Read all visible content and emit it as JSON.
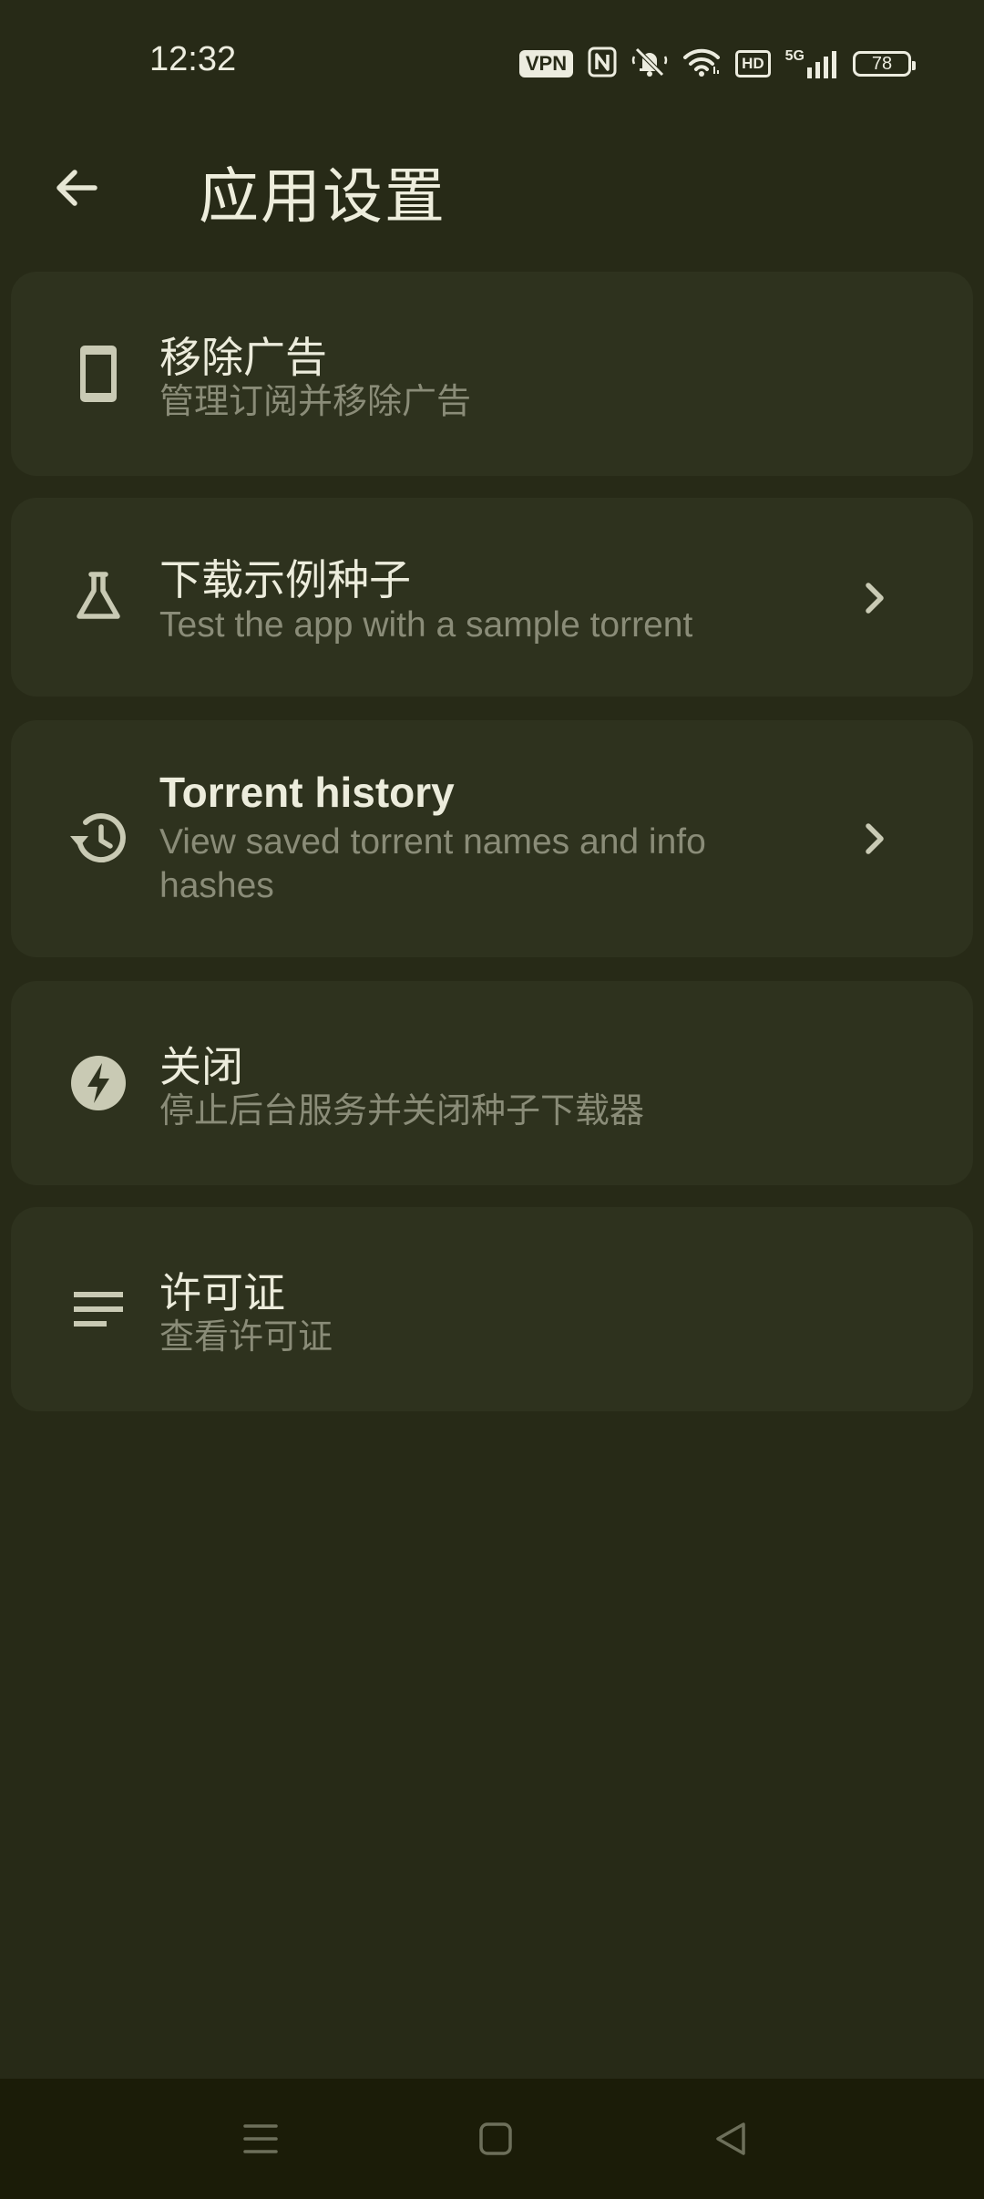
{
  "status_bar": {
    "time": "12:32",
    "vpn": "VPN",
    "hd": "HD",
    "network": "5G",
    "battery": "78"
  },
  "app_bar": {
    "title": "应用设置"
  },
  "settings": [
    {
      "title": "移除广告",
      "subtitle": "管理订阅并移除广告",
      "icon": "phone-icon",
      "has_chevron": false
    },
    {
      "title": "下载示例种子",
      "subtitle": "Test the app with a sample torrent",
      "icon": "flask-icon",
      "has_chevron": true
    },
    {
      "title": "Torrent history",
      "subtitle": "View saved torrent names and info hashes",
      "icon": "history-icon",
      "has_chevron": true
    },
    {
      "title": "关闭",
      "subtitle": "停止后台服务并关闭种子下载器",
      "icon": "bolt-icon",
      "has_chevron": false
    },
    {
      "title": "许可证",
      "subtitle": "查看许可证",
      "icon": "notes-icon",
      "has_chevron": false
    }
  ],
  "colors": {
    "background": "#272a17",
    "card": "#2e321e",
    "title_text": "#ececdc",
    "subtitle_text": "#8a8c78",
    "icon": "#c9cab4",
    "nav_bar": "#1b1c08"
  }
}
